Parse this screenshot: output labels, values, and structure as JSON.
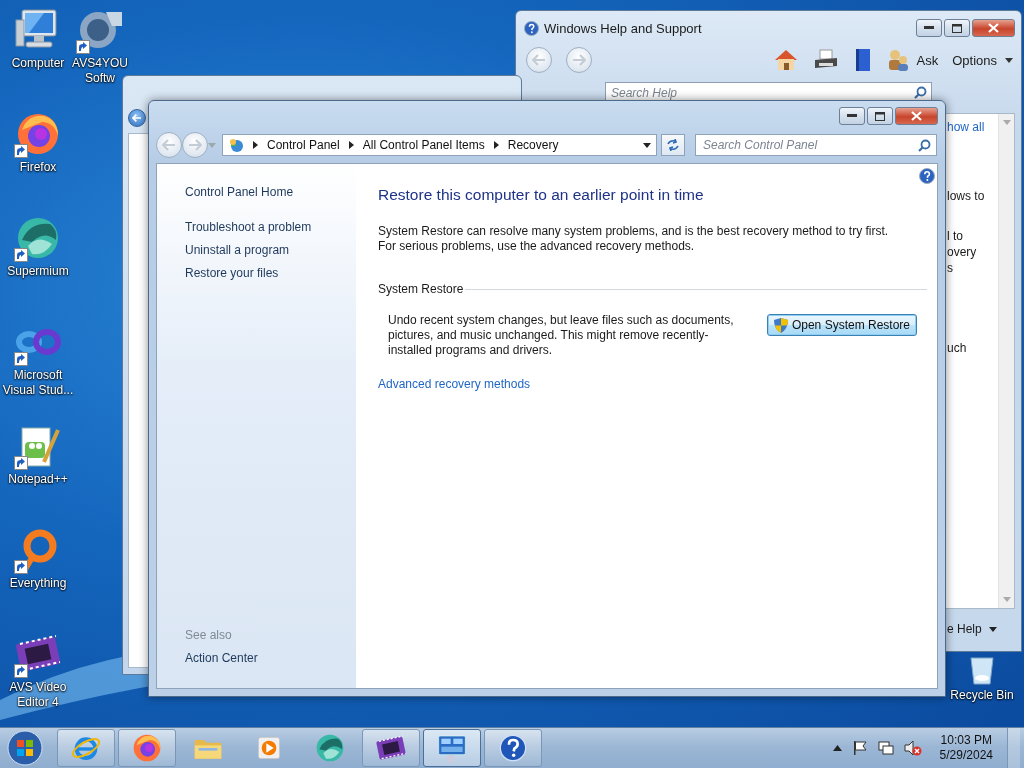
{
  "desktop": {
    "icons": [
      {
        "label": "Computer",
        "kind": "computer",
        "shortcut": false
      },
      {
        "label": "Firefox",
        "kind": "firefox",
        "shortcut": true
      },
      {
        "label": "Supermium",
        "kind": "supermium",
        "shortcut": true
      },
      {
        "label": "Microsoft Visual Stud...",
        "kind": "visual-studio",
        "shortcut": true
      },
      {
        "label": "Notepad++",
        "kind": "notepad",
        "shortcut": true
      },
      {
        "label": "Everything",
        "kind": "everything",
        "shortcut": true
      },
      {
        "label": "AVS Video Editor 4",
        "kind": "film",
        "shortcut": true
      },
      {
        "label": "AVS4YOU Softw",
        "kind": "avs4you",
        "shortcut": true
      }
    ],
    "recycle_bin": {
      "label": "Recycle Bin"
    }
  },
  "help_window": {
    "title": "Windows Help and Support",
    "ask": "Ask",
    "options": "Options",
    "search": {
      "placeholder": "Search Help"
    },
    "fragments": [
      {
        "text": "how all",
        "kind": "link"
      },
      {
        "text": "lows to",
        "kind": "text"
      },
      {
        "text": "l to",
        "kind": "text"
      },
      {
        "text": "overy",
        "kind": "text"
      },
      {
        "text": "s",
        "kind": "text"
      },
      {
        "text": "uch",
        "kind": "text"
      }
    ],
    "footer": "e Help"
  },
  "control_panel": {
    "breadcrumbs": [
      "Control Panel",
      "All Control Panel Items",
      "Recovery"
    ],
    "search": {
      "placeholder": "Search Control Panel"
    },
    "tasks": [
      "Control Panel Home",
      "Troubleshoot a problem",
      "Uninstall a program",
      "Restore your files"
    ],
    "see_also": {
      "heading": "See also",
      "items": [
        "Action Center"
      ]
    },
    "content": {
      "heading": "Restore this computer to an earlier point in time",
      "intro": "System Restore can resolve many system problems, and is the best recovery method to try first. For serious problems, use the advanced recovery methods.",
      "section_title": "System Restore",
      "description": "Undo recent system changes, but leave files such as documents, pictures, and music unchanged. This might remove recently-installed programs and drivers.",
      "button": "Open System Restore",
      "link": "Advanced recovery methods"
    }
  },
  "taskbar": {
    "items": [
      {
        "kind": "ie",
        "running": true,
        "selected": false
      },
      {
        "kind": "firefox",
        "running": true,
        "selected": false
      },
      {
        "kind": "folder",
        "running": false,
        "selected": false
      },
      {
        "kind": "media",
        "running": false,
        "selected": false
      },
      {
        "kind": "supermium",
        "running": false,
        "selected": false
      },
      {
        "kind": "film",
        "running": true,
        "selected": false
      },
      {
        "kind": "control-panel",
        "running": true,
        "selected": true
      },
      {
        "kind": "help",
        "running": true,
        "selected": false
      }
    ],
    "clock": {
      "time": "10:03 PM",
      "date": "5/29/2024"
    }
  }
}
